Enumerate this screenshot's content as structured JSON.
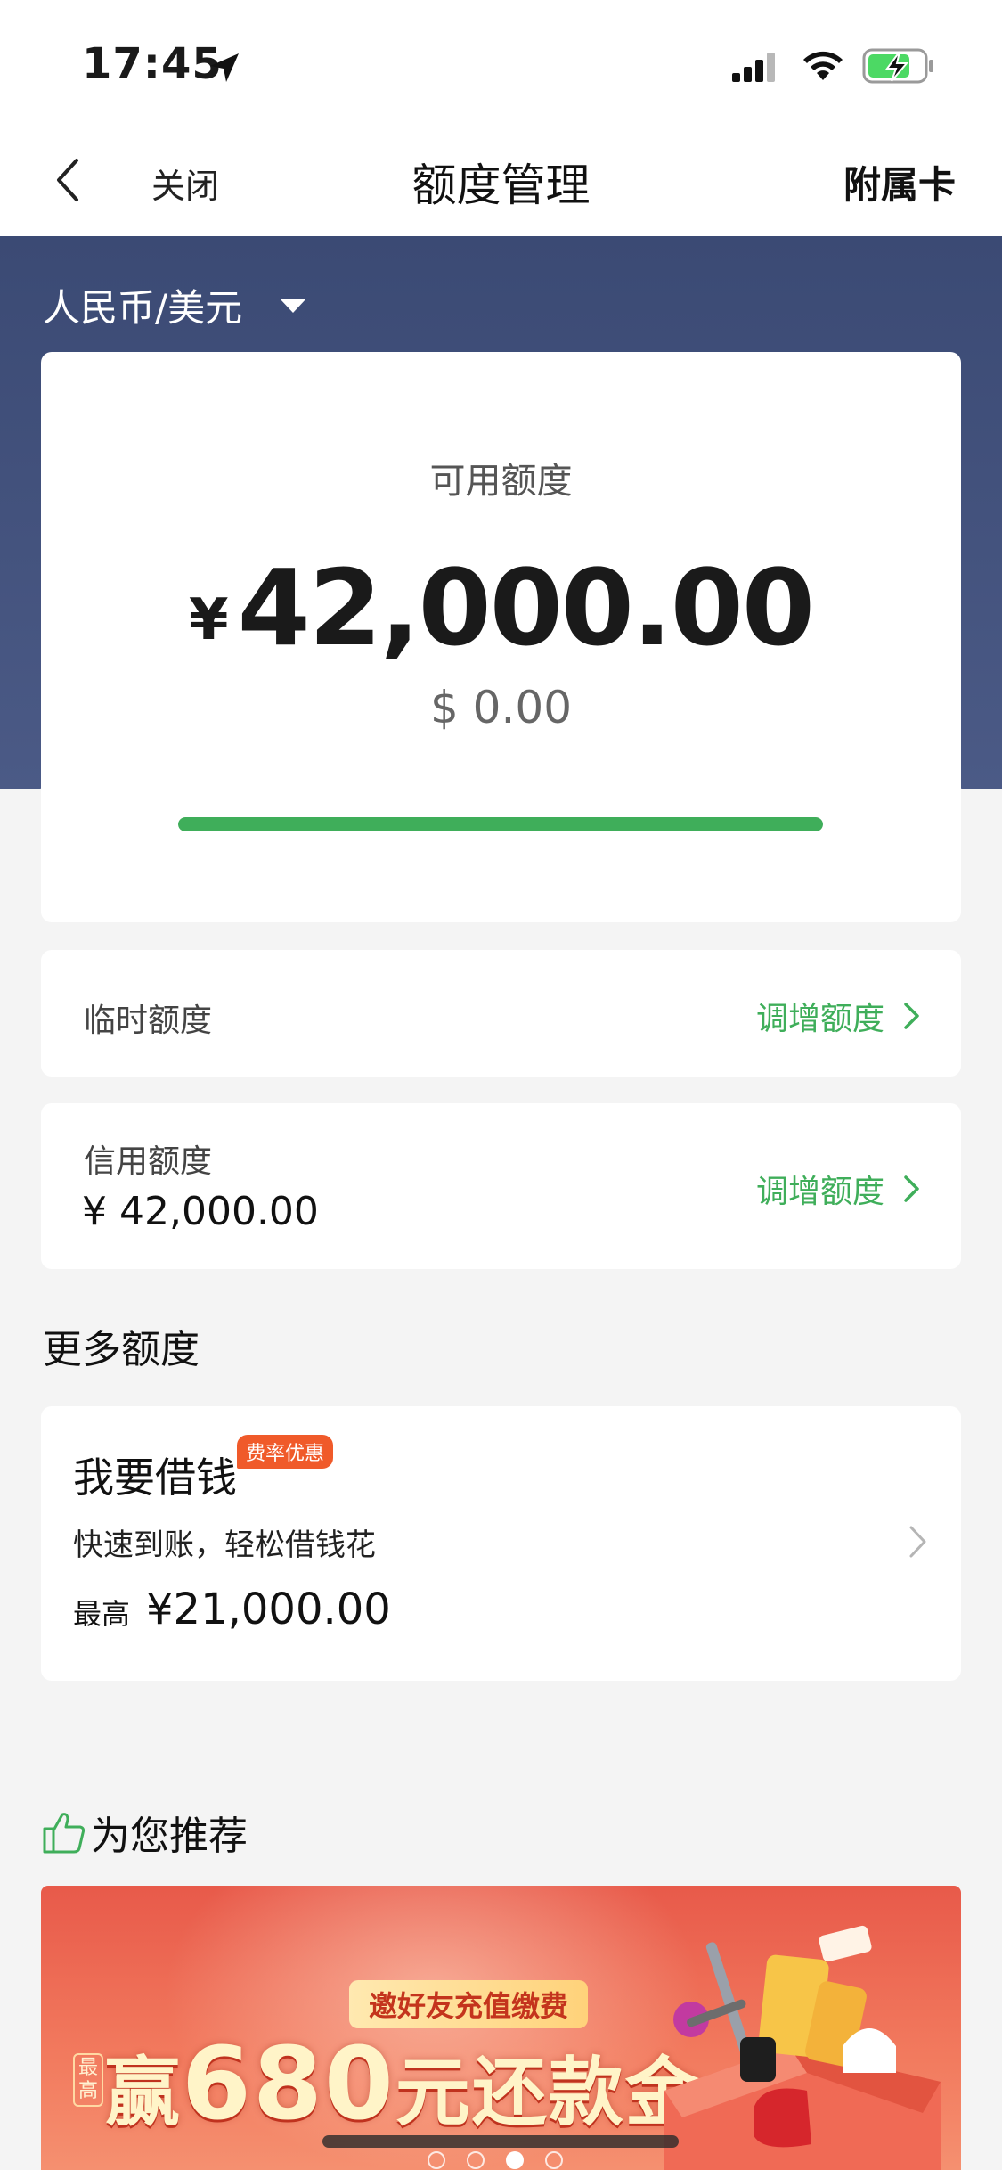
{
  "status_bar": {
    "time": "17:45"
  },
  "nav": {
    "close_label": "关闭",
    "title": "额度管理",
    "right_label": "附属卡"
  },
  "currency_selector": {
    "label": "人民币/美元"
  },
  "limit_card": {
    "available_label": "可用额度",
    "currency_symbol": "¥",
    "available_amount": "42,000.00",
    "usd_amount": "$ 0.00",
    "progress_fraction": 1.0,
    "progress_color": "#3fae5a"
  },
  "temporary_limit": {
    "label": "临时额度",
    "action": "调增额度"
  },
  "credit_limit": {
    "label": "信用额度",
    "value": "¥ 42,000.00",
    "action": "调增额度"
  },
  "more_section": {
    "title": "更多额度"
  },
  "loan": {
    "title": "我要借钱",
    "badge": "费率优惠",
    "description": "快速到账，轻松借钱花",
    "max_label": "最高",
    "max_value": "¥21,000.00"
  },
  "recommend": {
    "title": "为您推荐"
  },
  "banner": {
    "subtitle": "邀好友充值缴费",
    "max_tag": "最高",
    "headline_prefix": "赢",
    "headline_number": "680",
    "headline_suffix": "元还款金",
    "page_count": 4,
    "active_page": 3
  },
  "colors": {
    "accent": "#3fae5a",
    "header_bg": "#3b4a74",
    "badge": "#f05a2a"
  }
}
